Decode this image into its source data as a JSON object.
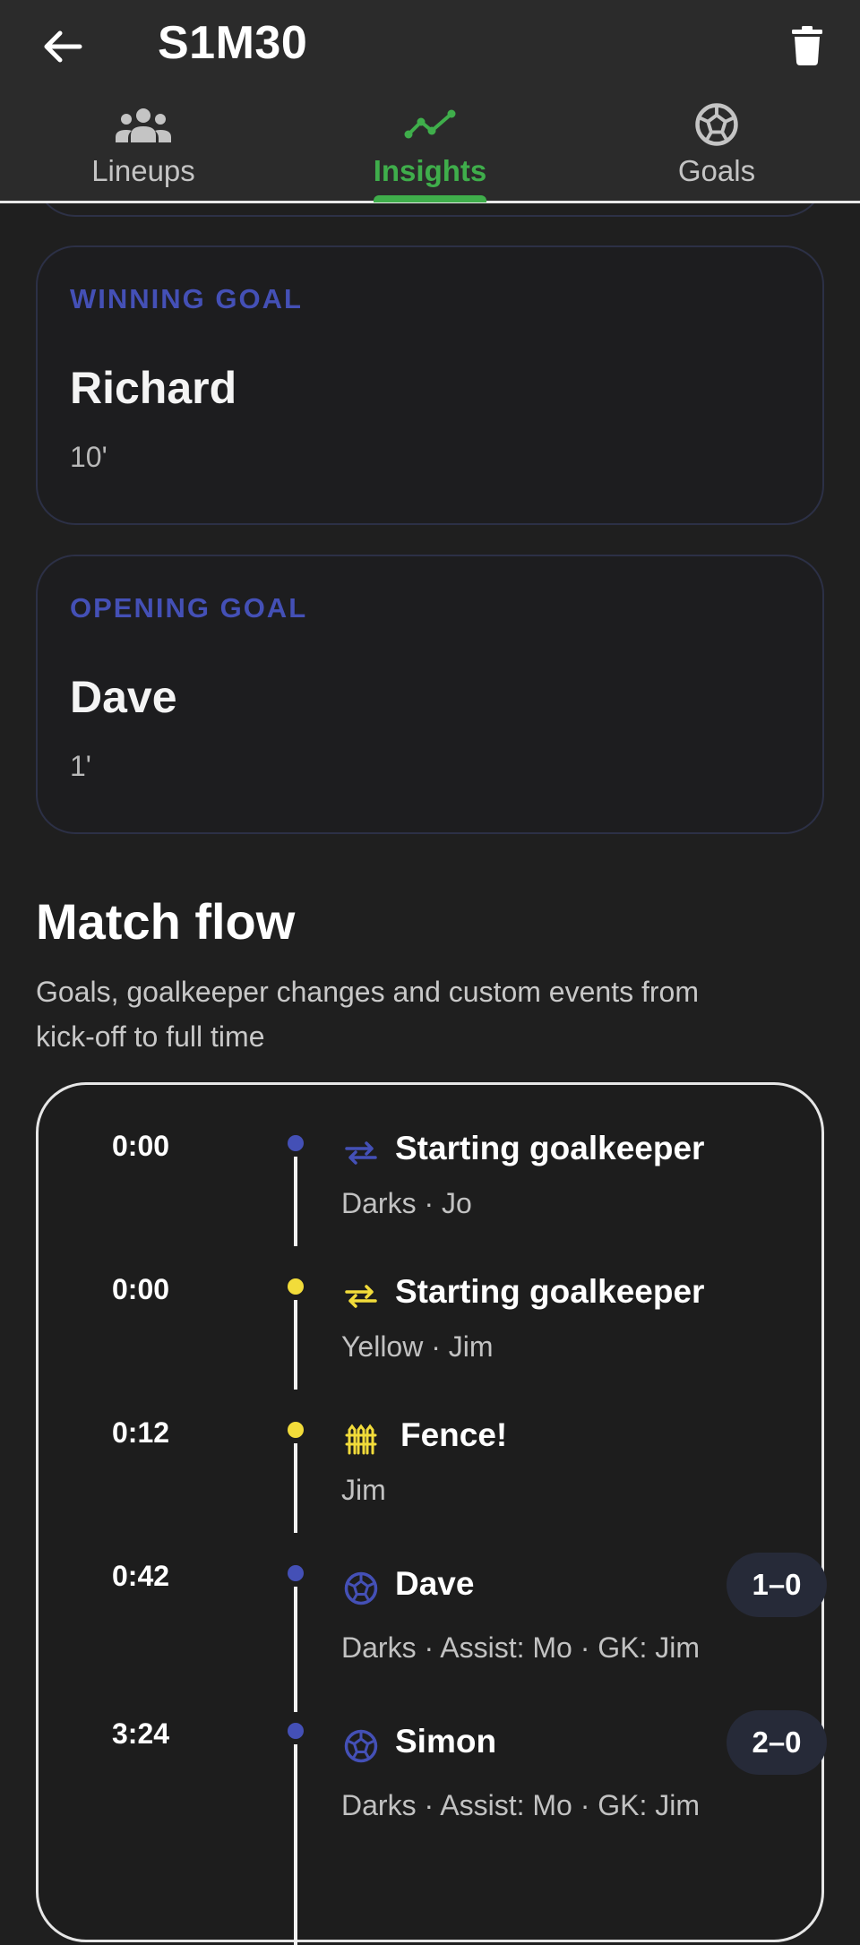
{
  "header": {
    "title": "S1M30",
    "back_icon": "arrow-left-icon",
    "delete_icon": "trash-icon"
  },
  "tabs": [
    {
      "label": "Lineups",
      "icon": "people-icon",
      "active": false
    },
    {
      "label": "Insights",
      "icon": "trend-line-icon",
      "active": true
    },
    {
      "label": "Goals",
      "icon": "soccer-ball-icon",
      "active": false
    }
  ],
  "cards": {
    "winning_goal": {
      "kicker": "WINNING GOAL",
      "name": "Richard",
      "minute": "10'"
    },
    "opening_goal": {
      "kicker": "OPENING GOAL",
      "name": "Dave",
      "minute": "1'"
    }
  },
  "match_flow": {
    "title": "Match flow",
    "subtitle_line1": "Goals, goalkeeper changes and custom events from",
    "subtitle_line2": "kick-off to full time",
    "events": [
      {
        "time": "0:00",
        "title": "Starting goalkeeper",
        "detail": "Darks · Jo",
        "icon": "swap-arrows-icon",
        "color": "#4450b6"
      },
      {
        "time": "0:00",
        "title": "Starting goalkeeper",
        "detail": "Yellow · Jim",
        "icon": "swap-arrows-icon",
        "color": "#f2dc3a"
      },
      {
        "time": "0:12",
        "title": "Fence!",
        "detail": "Jim",
        "icon": "fence-icon",
        "color": "#f2dc3a"
      },
      {
        "time": "0:42",
        "title": "Dave",
        "detail": "Darks · Assist: Mo · GK: Jim",
        "icon": "soccer-ball-icon",
        "color": "#4450b6",
        "score": "1–0"
      },
      {
        "time": "3:24",
        "title": "Simon",
        "detail": "Darks · Assist: Mo · GK: Jim",
        "icon": "soccer-ball-icon",
        "color": "#4450b6",
        "score": "2–0"
      }
    ]
  },
  "colors": {
    "accent_green": "#3fae4b",
    "darks_blue": "#4450b6",
    "yellow": "#f2dc3a",
    "background": "#1f1f1f",
    "appbar": "#2b2b2b"
  }
}
